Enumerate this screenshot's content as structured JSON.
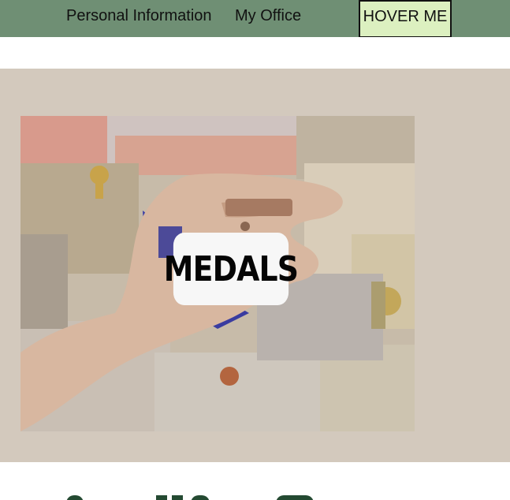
{
  "nav": {
    "items": [
      {
        "label": "Personal Information"
      },
      {
        "label": "My Office"
      }
    ],
    "hover_button": "HOVER ME"
  },
  "gallery": {
    "card_label": "MEDALS",
    "photo_icon": "photo-certificates-and-medal"
  },
  "colors": {
    "nav_bg": "#6f8f74",
    "hover_bg": "#dcf0c0",
    "section_bg": "#d3c9bd",
    "label_bg": "#f7f7f7",
    "peek_icons": "#244a32"
  }
}
